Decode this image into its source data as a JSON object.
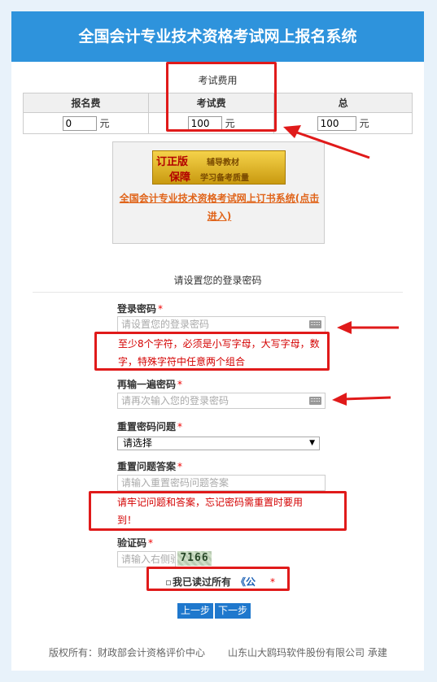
{
  "header": {
    "title": "全国会计专业技术资格考试网上报名系统"
  },
  "fee": {
    "caption": "考试费用",
    "columns": [
      "报名费",
      "考试费",
      "总"
    ],
    "values": [
      "0",
      "100",
      "100"
    ],
    "unit": "元"
  },
  "ad": {
    "banner_line1": "订正版",
    "banner_line1b": "辅导教材",
    "banner_line2": "保障",
    "banner_line2b": "学习备考质量",
    "link_text": "全国会计专业技术资格考试网上订书系统(点击进入)"
  },
  "password_section": {
    "caption": "请设置您的登录密码",
    "password_label": "登录密码",
    "password_placeholder": "请设置您的登录密码",
    "password_note": "至少8个字符，必须是小写字母，大写字母，数字，特殊字符中任意两个组合",
    "confirm_label": "再输一遍密码",
    "confirm_placeholder": "请再次输入您的登录密码",
    "question_label": "重置密码问题",
    "question_selected": "请选择",
    "answer_label": "重置问题答案",
    "answer_placeholder": "请输入重置密码问题答案",
    "answer_note": "请牢记问题和答案，忘记密码需重置时要用到！",
    "captcha_label": "验证码",
    "captcha_placeholder": "请输入右侧验证码",
    "captcha_code": "7166",
    "required_mark": "*"
  },
  "agreement": {
    "text": "我已读过所有",
    "link": "《公",
    "star": "*"
  },
  "buttons": {
    "prev": "上一步",
    "next": "下一步"
  },
  "footer": {
    "left": "版权所有：财政部会计资格评价中心",
    "right": "山东山大鸥玛软件股份有限公司 承建"
  },
  "colors": {
    "header": "#2e93dc",
    "highlight": "#e01a1a",
    "button": "#1f78cd",
    "note": "#d40000"
  }
}
